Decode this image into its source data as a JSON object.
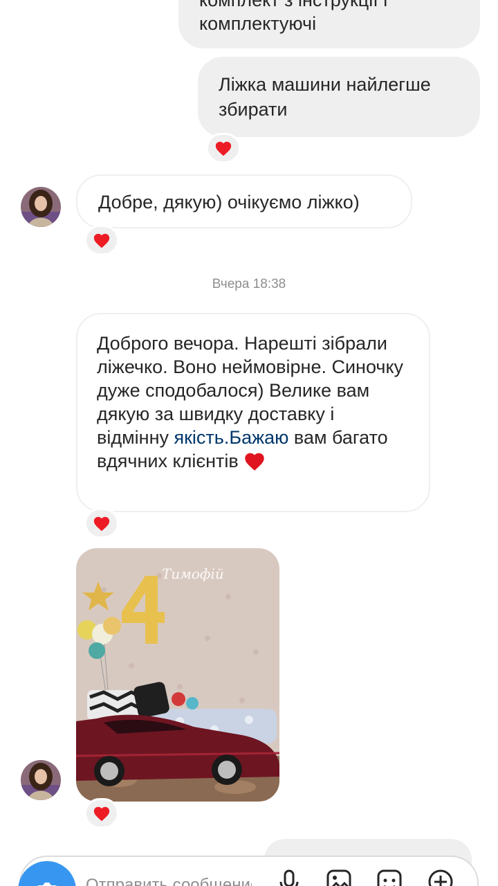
{
  "messages": {
    "out_1_tail": "комплектуючі",
    "out_1_cut": "комплект з інструкції і",
    "out_2": "Ліжка машини найлегше збирати",
    "in_1": "Добре, дякую) очікуємо ліжко)",
    "timestamp": "Вчера 18:38",
    "in_2_part1": "Доброго вечора. Нарешті зібрали ліжечко. Воно неймовірне. Синочку дуже сподобалося) Велике вам дякую за швидку доставку і відмінну ",
    "in_2_link": "якість.Бажаю",
    "in_2_part2": " вам багато вдячних клієнтів ",
    "photo_caption": "Тимофій"
  },
  "composer": {
    "placeholder": "Отправить сообщение..."
  },
  "icons": {
    "reaction": "heart-icon",
    "camera": "camera-icon",
    "mic": "microphone-icon",
    "gallery": "gallery-icon",
    "sticker": "sticker-icon",
    "plus": "plus-icon"
  },
  "colors": {
    "heart": "#ed1c24",
    "accent": "#3797f0",
    "link": "#00376b",
    "bubble_out": "#efefef"
  }
}
